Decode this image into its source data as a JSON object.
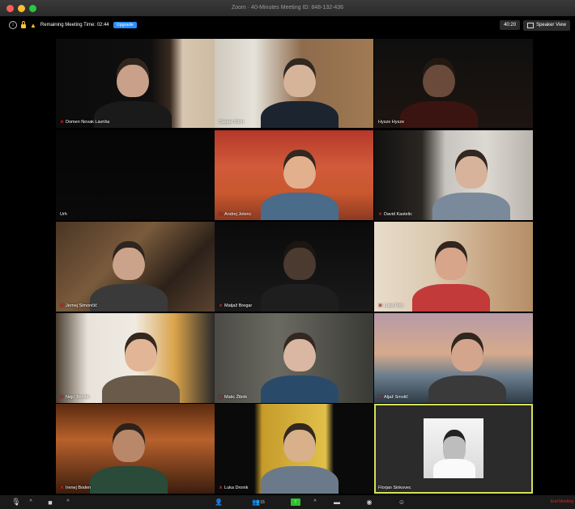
{
  "window": {
    "title": "Zoom · 40-Minutes Meeting ID: 848-132-436"
  },
  "infobar": {
    "remaining": "Remaining Meeting Time: 02:44",
    "upgrade": "Upgrade",
    "timer": "40:20",
    "view": "Speaker View"
  },
  "participants": [
    {
      "name": "Domen Novak Lavriša",
      "muted": true
    },
    {
      "name": "Casper Otrin",
      "muted": false
    },
    {
      "name": "Hysze Hysze",
      "muted": false
    },
    {
      "name": "Urh",
      "muted": false
    },
    {
      "name": "Andrej Jelenc",
      "muted": true
    },
    {
      "name": "David Kastelic",
      "muted": true
    },
    {
      "name": "Jernej Simončič",
      "muted": true
    },
    {
      "name": "Matjaž Bregar",
      "muted": true
    },
    {
      "name": "Luka Polc",
      "muted": true
    },
    {
      "name": "Nejc Tomšič",
      "muted": true
    },
    {
      "name": "Matic Žibrik",
      "muted": true
    },
    {
      "name": "Aljaž Smolič",
      "muted": true
    },
    {
      "name": "Irenej Boden",
      "muted": true
    },
    {
      "name": "Luka Dronik",
      "muted": true
    },
    {
      "name": "Florjan Sinkovec",
      "muted": false
    }
  ],
  "toolbar": {
    "participants_count": "15",
    "end": "End Meeting"
  },
  "colors": {
    "accent": "#2d8cff",
    "active_speaker": "#d4e157",
    "muted": "#e02828",
    "share": "#2ec22e"
  }
}
